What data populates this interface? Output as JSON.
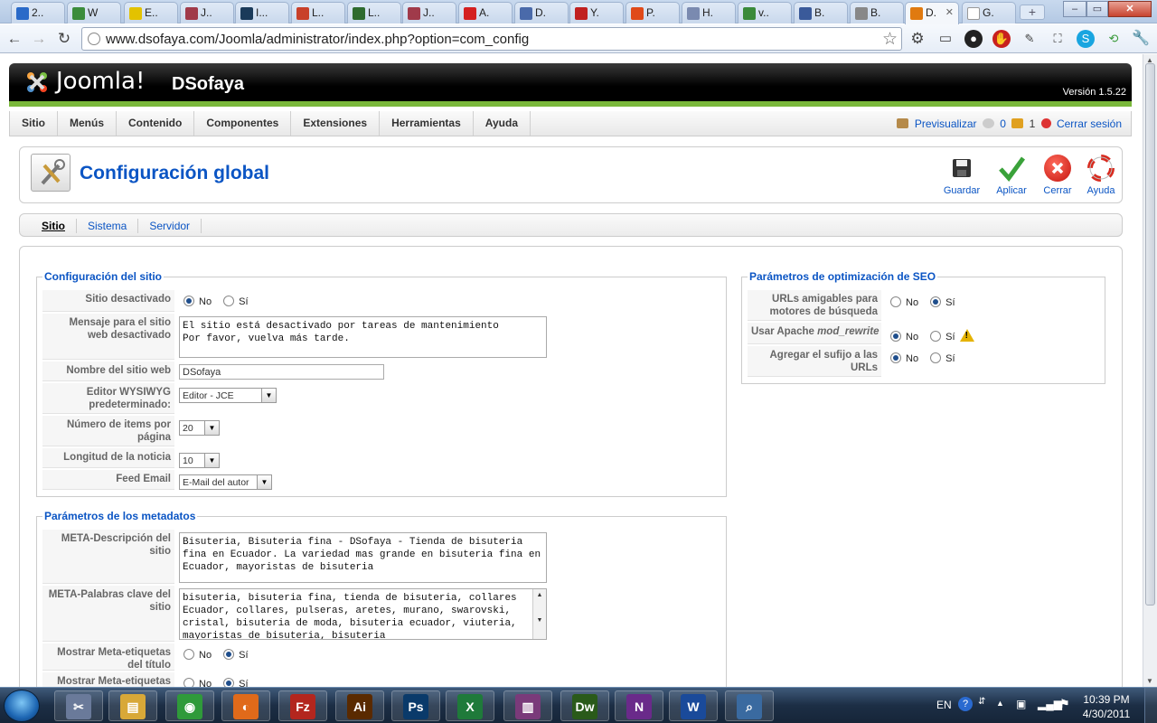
{
  "browser": {
    "tabs": [
      {
        "label": "2..",
        "color": "#2a6ac8"
      },
      {
        "label": "W",
        "color": "#3c8c3c"
      },
      {
        "label": "E..",
        "color": "#e3c200"
      },
      {
        "label": "J..",
        "color": "#a03a4a"
      },
      {
        "label": "I...",
        "color": "#1a3a5a"
      },
      {
        "label": "L..",
        "color": "#c8402a"
      },
      {
        "label": "L..",
        "color": "#2f6b2f"
      },
      {
        "label": "J..",
        "color": "#a03a4a"
      },
      {
        "label": "A.",
        "color": "#d42020"
      },
      {
        "label": "D.",
        "color": "#4a6aaa"
      },
      {
        "label": "Y.",
        "color": "#c02020"
      },
      {
        "label": "P.",
        "color": "#e04a1a"
      },
      {
        "label": "H.",
        "color": "#7a8ab0"
      },
      {
        "label": "v..",
        "color": "#3a8a3a"
      },
      {
        "label": "B.",
        "color": "#3a5a9a"
      },
      {
        "label": "B.",
        "color": "#888888"
      },
      {
        "label": "D.",
        "color": "#e07a10"
      },
      {
        "label": "G.",
        "color": "#ffffff"
      }
    ],
    "active_tab_index": 16,
    "url": "www.dsofaya.com/Joomla/administrator/index.php?option=com_config"
  },
  "joomla": {
    "logo_text": "Joomla!",
    "site_name": "DSofaya",
    "version": "Versión 1.5.22",
    "menu": [
      "Sitio",
      "Menús",
      "Contenido",
      "Componentes",
      "Extensiones",
      "Herramientas",
      "Ayuda"
    ],
    "status": {
      "preview": "Previsualizar",
      "messages": "0",
      "users": "1",
      "logout": "Cerrar sesión"
    },
    "title": "Configuración global",
    "toolbar": {
      "save": "Guardar",
      "apply": "Aplicar",
      "close": "Cerrar",
      "help": "Ayuda"
    },
    "subnav": [
      "Sitio",
      "Sistema",
      "Servidor"
    ]
  },
  "site_config": {
    "legend": "Configuración del sitio",
    "offline": {
      "label": "Sitio desactivado",
      "opt_no": "No",
      "opt_yes": "Sí",
      "value": "No"
    },
    "offline_message": {
      "label": "Mensaje para el sitio web desactivado",
      "value": "El sitio está desactivado por tareas de mantenimiento\nPor favor, vuelva más tarde."
    },
    "site_name": {
      "label": "Nombre del sitio web",
      "value": "DSofaya"
    },
    "editor": {
      "label": "Editor WYSIWYG predeterminado:",
      "value": "Editor - JCE"
    },
    "list_limit": {
      "label": "Número de items por página",
      "value": "20"
    },
    "feed_limit": {
      "label": "Longitud de la noticia",
      "value": "10"
    },
    "feed_email": {
      "label": "Feed Email",
      "value": "E-Mail del autor"
    }
  },
  "metadata": {
    "legend": "Parámetros de los metadatos",
    "meta_desc": {
      "label": "META-Descripción del sitio",
      "value": "Bisuteria, Bisuteria fina - DSofaya - Tienda de bisuteria fina en Ecuador. La variedad mas grande en bisuteria fina en Ecuador, mayoristas de bisuteria"
    },
    "meta_keys": {
      "label": "META-Palabras clave del sitio",
      "value": "bisuteria, bisuteria fina, tienda de bisuteria, collares Ecuador, collares, pulseras, aretes, murano, swarovski, cristal, bisuteria de moda, bisuteria ecuador, viuteria, mayoristas de bisuteria, bisuteria"
    },
    "meta_title": {
      "label": "Mostrar Meta-etiquetas del título",
      "opt_no": "No",
      "opt_yes": "Sí",
      "value": "Sí"
    },
    "meta_author": {
      "label": "Mostrar Meta-etiquetas",
      "opt_no": "No",
      "opt_yes": "Sí",
      "value": "Sí"
    }
  },
  "seo": {
    "legend": "Parámetros de optimización de SEO",
    "sef": {
      "label": "URLs amigables para motores de búsqueda",
      "opt_no": "No",
      "opt_yes": "Sí",
      "value": "Sí"
    },
    "rewrite": {
      "label_a": "Usar Apache ",
      "label_b": "mod_rewrite",
      "opt_no": "No",
      "opt_yes": "Sí",
      "value": "No"
    },
    "suffix": {
      "label": "Agregar el sufijo a las URLs",
      "opt_no": "No",
      "opt_yes": "Sí",
      "value": "No"
    }
  },
  "taskbar": {
    "apps": [
      {
        "name": "snipping-tool",
        "glyph": "✂",
        "color": "#6a7a9a"
      },
      {
        "name": "explorer",
        "glyph": "▤",
        "color": "#d8a838"
      },
      {
        "name": "chrome",
        "glyph": "◉",
        "color": "#2f9a3a"
      },
      {
        "name": "firefox",
        "glyph": "◐",
        "color": "#e06a1a"
      },
      {
        "name": "filezilla",
        "glyph": "Fz",
        "color": "#b3261e"
      },
      {
        "name": "illustrator",
        "glyph": "Ai",
        "color": "#5a2a00"
      },
      {
        "name": "photoshop",
        "glyph": "Ps",
        "color": "#0a3a6a"
      },
      {
        "name": "excel",
        "glyph": "X",
        "color": "#1f7a3a"
      },
      {
        "name": "winrar",
        "glyph": "▥",
        "color": "#7a3a7a"
      },
      {
        "name": "dreamweaver",
        "glyph": "Dw",
        "color": "#2a5a1a"
      },
      {
        "name": "onenote",
        "glyph": "N",
        "color": "#6a2a8a"
      },
      {
        "name": "word",
        "glyph": "W",
        "color": "#1a4a9a"
      },
      {
        "name": "search-pro",
        "glyph": "⌕",
        "color": "#3a6aa0"
      }
    ],
    "lang": "EN",
    "time": "10:39 PM",
    "date": "4/30/2011"
  }
}
